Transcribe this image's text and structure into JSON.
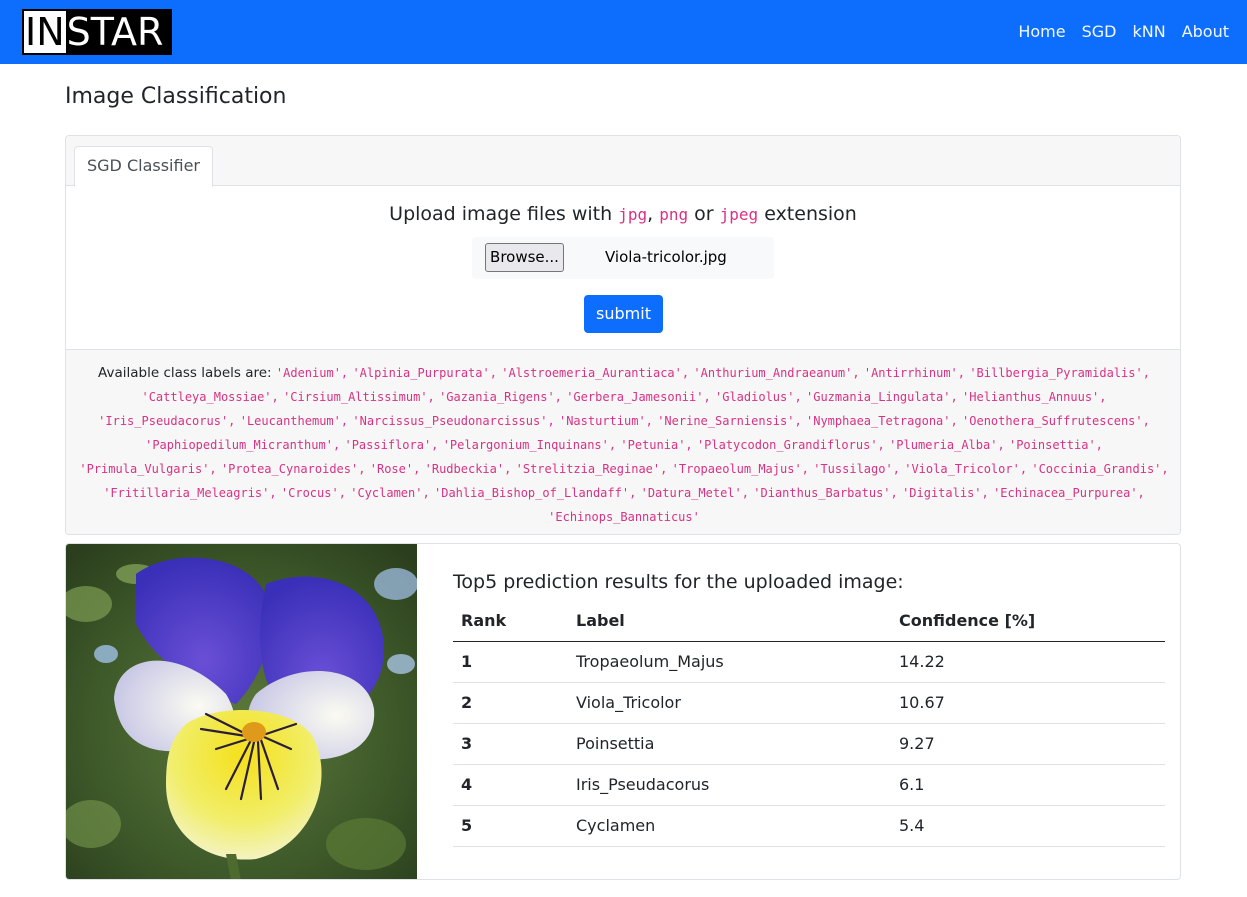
{
  "navbar": {
    "brand_part1": "IN",
    "brand_part2": "STAR",
    "links": [
      "Home",
      "SGD",
      "kNN",
      "About"
    ]
  },
  "page_title": "Image Classification",
  "classifier_card": {
    "tab_label": "SGD Classifier",
    "upload": {
      "text_before": "Upload image files with ",
      "ext1": "jpg",
      "sep1": ", ",
      "ext2": "png",
      "sep2": " or ",
      "ext3": "jpeg",
      "text_after": " extension"
    },
    "browse_label": "Browse...",
    "file_name": "Viola-tricolor.jpg",
    "submit_label": "submit",
    "labels_intro": "Available class labels are: ",
    "class_labels": [
      "Adenium",
      "Alpinia_Purpurata",
      "Alstroemeria_Aurantiaca",
      "Anthurium_Andraeanum",
      "Antirrhinum",
      "Billbergia_Pyramidalis",
      "Cattleya_Mossiae",
      "Cirsium_Altissimum",
      "Gazania_Rigens",
      "Gerbera_Jamesonii",
      "Gladiolus",
      "Guzmania_Lingulata",
      "Helianthus_Annuus",
      "Iris_Pseudacorus",
      "Leucanthemum",
      "Narcissus_Pseudonarcissus",
      "Nasturtium",
      "Nerine_Sarniensis",
      "Nymphaea_Tetragona",
      "Oenothera_Suffrutescens",
      "Paphiopedilum_Micranthum",
      "Passiflora",
      "Pelargonium_Inquinans",
      "Petunia",
      "Platycodon_Grandiflorus",
      "Plumeria_Alba",
      "Poinsettia",
      "Primula_Vulgaris",
      "Protea_Cynaroides",
      "Rose",
      "Rudbeckia",
      "Strelitzia_Reginae",
      "Tropaeolum_Majus",
      "Tussilago",
      "Viola_Tricolor",
      "Coccinia_Grandis",
      "Fritillaria_Meleagris",
      "Crocus",
      "Cyclamen",
      "Dahlia_Bishop_of_Llandaff",
      "Datura_Metel",
      "Dianthus_Barbatus",
      "Digitalis",
      "Echinacea_Purpurea",
      "Echinops_Bannaticus"
    ]
  },
  "results": {
    "title": "Top5 prediction results for the uploaded image:",
    "columns": [
      "Rank",
      "Label",
      "Confidence [%]"
    ],
    "rows": [
      {
        "rank": "1",
        "label": "Tropaeolum_Majus",
        "confidence": "14.22"
      },
      {
        "rank": "2",
        "label": "Viola_Tricolor",
        "confidence": "10.67"
      },
      {
        "rank": "3",
        "label": "Poinsettia",
        "confidence": "9.27"
      },
      {
        "rank": "4",
        "label": "Iris_Pseudacorus",
        "confidence": "6.1"
      },
      {
        "rank": "5",
        "label": "Cyclamen",
        "confidence": "5.4"
      }
    ]
  },
  "colors": {
    "primary": "#0d6efd",
    "code": "#d63384"
  }
}
